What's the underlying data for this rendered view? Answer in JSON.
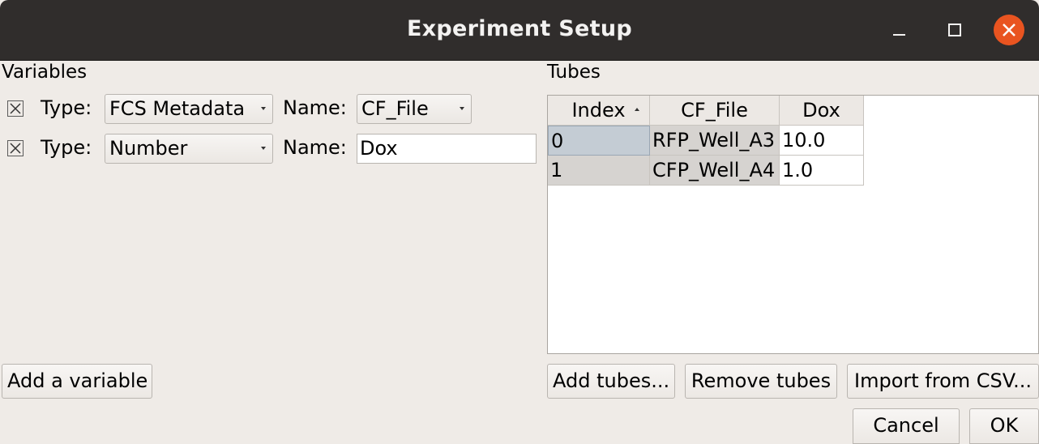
{
  "window": {
    "title": "Experiment Setup",
    "colors": {
      "titlebar": "#302d2c",
      "close_button": "#e95420",
      "background": "#efebe7"
    }
  },
  "variables": {
    "section_label": "Variables",
    "rows": [
      {
        "remove_icon": "x-box-icon",
        "type_label": "Type:",
        "type_value": "FCS Metadata",
        "name_label": "Name:",
        "name_value": "CF_File",
        "name_control": "combo"
      },
      {
        "remove_icon": "x-box-icon",
        "type_label": "Type:",
        "type_value": "Number",
        "name_label": "Name:",
        "name_value": "Dox",
        "name_control": "text"
      }
    ],
    "add_button": "Add a variable"
  },
  "tubes": {
    "section_label": "Tubes",
    "columns": [
      "Index",
      "CF_File",
      "Dox"
    ],
    "sorted_column": "Index",
    "rows": [
      [
        "0",
        "RFP_Well_A3",
        "10.0"
      ],
      [
        "1",
        "CFP_Well_A4",
        "1.0"
      ]
    ],
    "buttons": {
      "add": "Add tubes...",
      "remove": "Remove tubes",
      "import": "Import from CSV..."
    }
  },
  "dialog_buttons": {
    "cancel": "Cancel",
    "ok": "OK"
  }
}
